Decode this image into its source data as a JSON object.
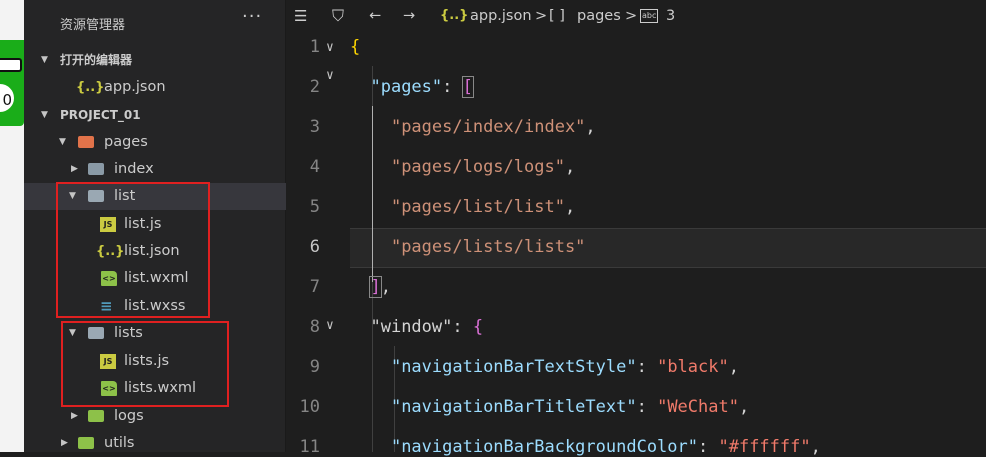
{
  "sidebar": {
    "title": "资源管理器",
    "more": "···",
    "open_editors": {
      "label": "打开的编辑器",
      "items": [
        {
          "icon": "json-icon",
          "name": "app.json"
        }
      ]
    },
    "project": {
      "label": "PROJECT_01",
      "tree": [
        {
          "name": "pages",
          "icon": "folder-open-icon",
          "expanded": true
        },
        {
          "name": "index",
          "icon": "folder-icon",
          "expanded": false
        },
        {
          "name": "list",
          "icon": "folder-open-icon",
          "expanded": true,
          "selected": true
        },
        {
          "name": "list.js",
          "icon": "js-icon"
        },
        {
          "name": "list.json",
          "icon": "json-icon"
        },
        {
          "name": "list.wxml",
          "icon": "wxml-icon"
        },
        {
          "name": "list.wxss",
          "icon": "css-icon"
        },
        {
          "name": "lists",
          "icon": "folder-open-icon",
          "expanded": true
        },
        {
          "name": "lists.js",
          "icon": "js-icon"
        },
        {
          "name": "lists.wxml",
          "icon": "wxml-icon"
        },
        {
          "name": "logs",
          "icon": "folder-icon",
          "expanded": false
        },
        {
          "name": "utils",
          "icon": "folder-icon",
          "expanded": false
        }
      ]
    }
  },
  "simulator": {
    "circle_text": "0"
  },
  "editor": {
    "breadcrumb": {
      "file": "app.json",
      "sep1": ">",
      "array_icon": "[ ]",
      "key": "pages",
      "sep2": ">",
      "abc_icon": "abc",
      "index": "3"
    },
    "current_line": 6,
    "lines": [
      {
        "n": "1",
        "text": "{"
      },
      {
        "n": "2",
        "key": "\"pages\"",
        "colon": ": ",
        "open": "["
      },
      {
        "n": "3",
        "str": "\"pages/index/index\"",
        "tail": ","
      },
      {
        "n": "4",
        "str": "\"pages/logs/logs\"",
        "tail": ","
      },
      {
        "n": "5",
        "str": "\"pages/list/list\"",
        "tail": ","
      },
      {
        "n": "6",
        "str": "\"pages/lists/lists\"",
        "tail": ""
      },
      {
        "n": "7",
        "close": "]",
        "tail": ","
      },
      {
        "n": "8",
        "key": "\"window\"",
        "colon": ": ",
        "open": "{"
      },
      {
        "n": "9",
        "key": "\"navigationBarTextStyle\"",
        "colon": ": ",
        "val": "\"black\"",
        "tail": ","
      },
      {
        "n": "10",
        "key": "\"navigationBarTitleText\"",
        "colon": ": ",
        "val": "\"WeChat\"",
        "tail": ","
      },
      {
        "n": "11",
        "key": "\"navigationBarBackgroundColor\"",
        "colon": ": ",
        "val": "\"#ffffff\"",
        "tail": ","
      }
    ]
  },
  "colors": {
    "highlight_box": "#e02020",
    "accent_green": "#1aad19"
  }
}
